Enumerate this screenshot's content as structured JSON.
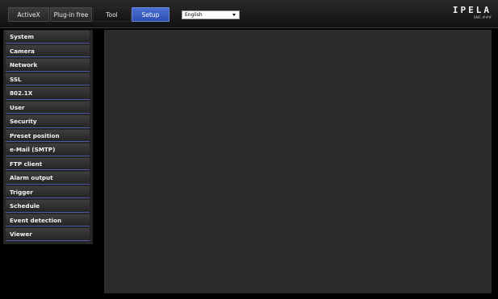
{
  "topbar": {
    "tabs": [
      {
        "label": "ActiveX"
      },
      {
        "label": "Plug-in free"
      },
      {
        "label": "Tool"
      },
      {
        "label": "Setup",
        "active": true
      }
    ],
    "language": {
      "selected": "English"
    },
    "logo": {
      "word": "IPELA",
      "model": "SNC-###"
    }
  },
  "sidebar": {
    "items": [
      {
        "label": "System"
      },
      {
        "label": "Camera"
      },
      {
        "label": "Network"
      },
      {
        "label": "SSL"
      },
      {
        "label": "802.1X"
      },
      {
        "label": "User"
      },
      {
        "label": "Security"
      },
      {
        "label": "Preset position"
      },
      {
        "label": "e-Mail (SMTP)"
      },
      {
        "label": "FTP client"
      },
      {
        "label": "Alarm output"
      },
      {
        "label": "Trigger"
      },
      {
        "label": "Schedule"
      },
      {
        "label": "Event detection"
      },
      {
        "label": "Viewer"
      }
    ]
  },
  "colors": {
    "active_tab": "#3d5fc4",
    "menu_underline": "#5058a8",
    "background": "#000000",
    "panel": "#2a2a2a"
  }
}
